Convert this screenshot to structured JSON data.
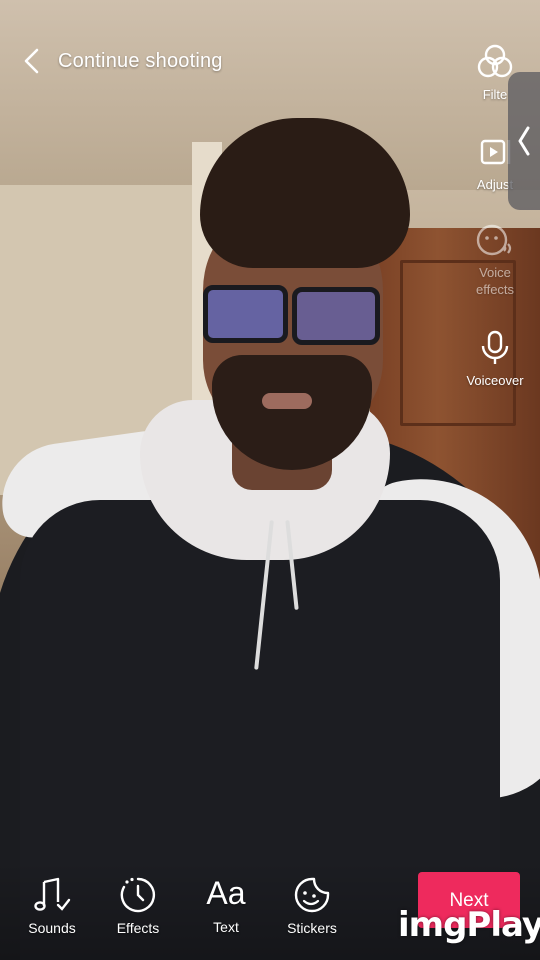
{
  "header": {
    "title": "Continue shooting"
  },
  "side_tools": [
    {
      "label": "Filters",
      "icon": "filters-icon"
    },
    {
      "label": "Adjust",
      "icon": "adjust-clips-icon"
    },
    {
      "label": "Voice effects",
      "icon": "voice-effects-icon"
    },
    {
      "label": "Voiceover",
      "icon": "microphone-icon"
    }
  ],
  "side_visible_labels": [
    "Filte",
    "Adjust",
    "Voice\neffects",
    "Voiceover"
  ],
  "bottom_tools": [
    {
      "label": "Sounds",
      "icon": "music-note-icon"
    },
    {
      "label": "Effects",
      "icon": "effects-timer-icon"
    },
    {
      "label": "Text",
      "glyph": "Aa"
    },
    {
      "label": "Stickers",
      "icon": "sticker-smiley-icon"
    }
  ],
  "next_button": {
    "label": "Next",
    "color": "#ee2a5d"
  },
  "watermark": {
    "text": "imgPlay"
  }
}
